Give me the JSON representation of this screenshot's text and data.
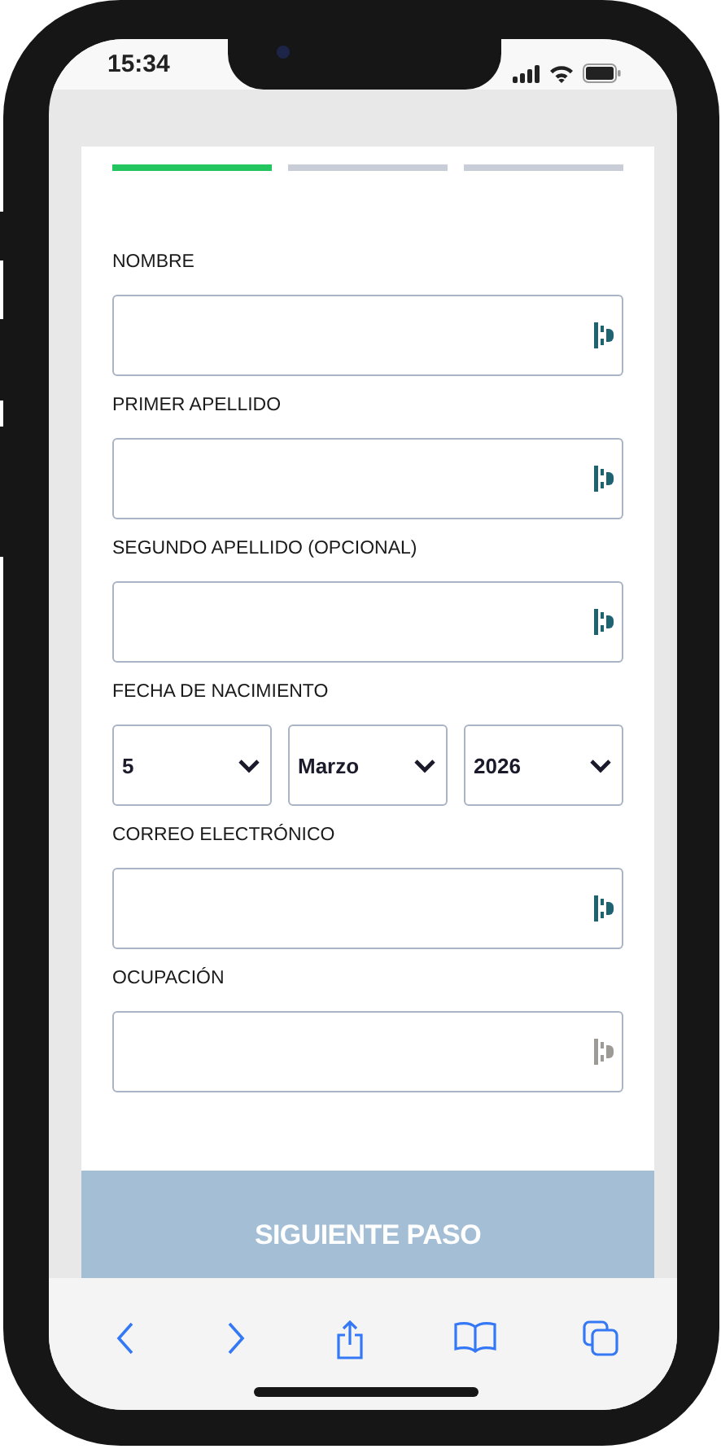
{
  "status_bar": {
    "time": "15:34"
  },
  "progress": [
    {
      "done": true
    },
    {
      "done": false
    },
    {
      "done": false
    }
  ],
  "form": [
    {
      "kind": "text",
      "label": "NOMBRE",
      "icon_active": true
    },
    {
      "kind": "text",
      "label": "PRIMER APELLIDO",
      "icon_active": true
    },
    {
      "kind": "text",
      "label": "SEGUNDO APELLIDO (OPCIONAL)",
      "icon_active": true
    },
    {
      "kind": "date",
      "label": "FECHA DE NACIMIENTO",
      "selects": [
        "5",
        "Marzo",
        "2026"
      ]
    },
    {
      "kind": "text",
      "label": "CORREO ELECTRÓNICO",
      "icon_active": true
    },
    {
      "kind": "text",
      "label": "OCUPACIÓN",
      "icon_active": false
    }
  ],
  "submit": {
    "label": "SIGUIENTE PASO",
    "disabled": true
  }
}
